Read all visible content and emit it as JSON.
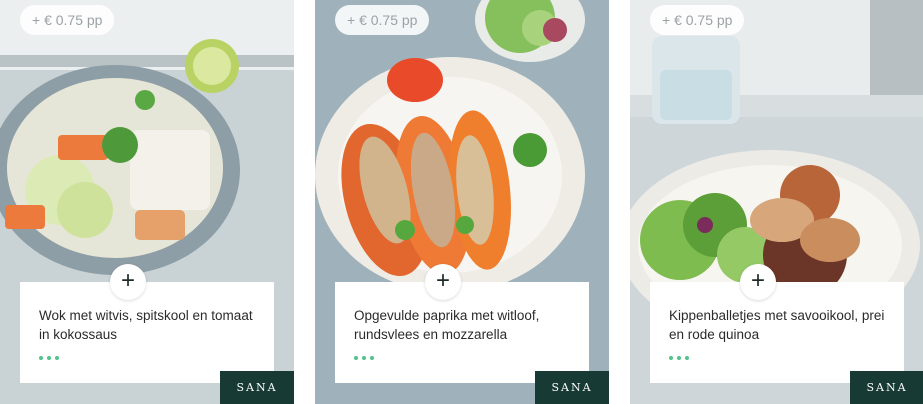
{
  "recipes": [
    {
      "price": "+ € 0.75 pp",
      "title": "Wok met witvis, spitskool en tomaat in kokossaus",
      "brand": "SANA"
    },
    {
      "price": "+ € 0.75 pp",
      "title": "Opgevulde paprika met witloof, rundsvlees en mozzarella",
      "brand": "SANA"
    },
    {
      "price": "+ € 0.75 pp",
      "title": "Kippenballetjes met savooikool, prei en rode quinoa",
      "brand": "SANA"
    }
  ],
  "add_label": "+",
  "colors": {
    "accent_dots": "#52c38b",
    "brand_tag": "#173a35"
  }
}
